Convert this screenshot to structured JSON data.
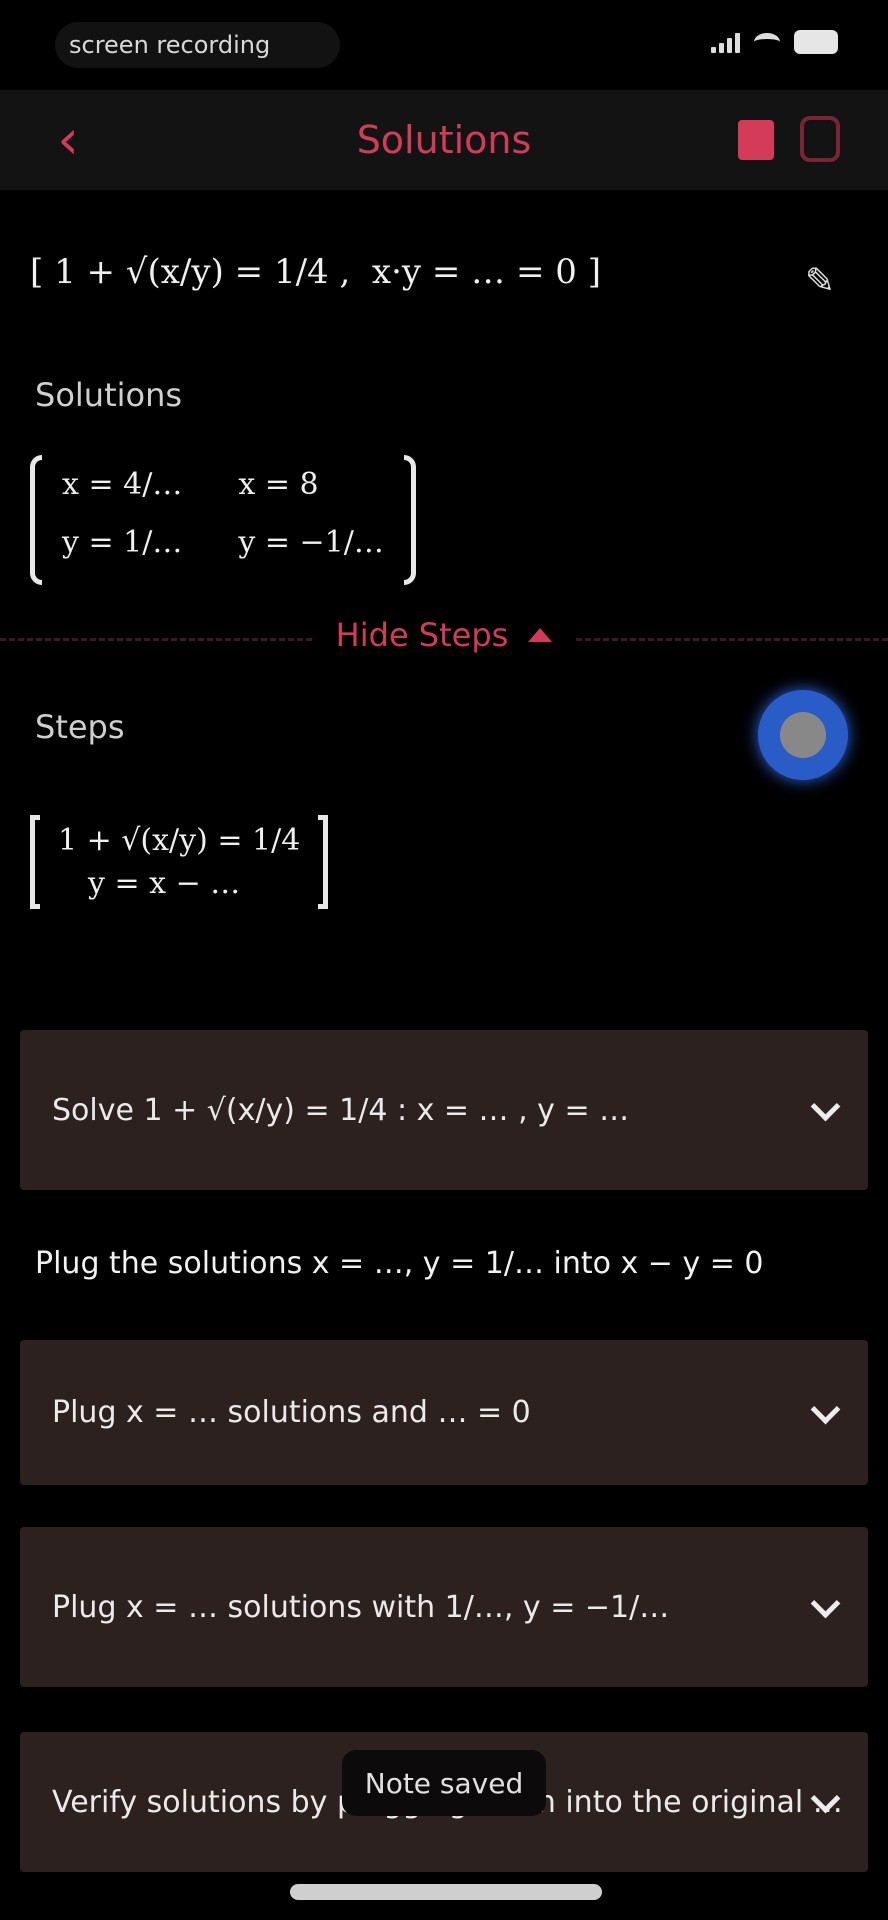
{
  "status_bar": {
    "left_pill_text": "screen recording",
    "battery_level": 1.0
  },
  "nav": {
    "back_icon": "chevron-left-icon",
    "title": "Solutions",
    "bookmark_icon": "bookmark-icon",
    "share_icon": "share-icon",
    "accent_color": "#d33b59"
  },
  "problem": {
    "expression": "[ 1 + √(x/y) = 1/4 ,  x·y = … = 0 ]",
    "edit_icon": "pencil-icon"
  },
  "solutions": {
    "label": "Solutions",
    "rows": [
      [
        "x = 4/…",
        "x = 8"
      ],
      [
        "y = 1/…",
        "y = −1/…"
      ]
    ]
  },
  "steps_toggle": {
    "label": "Hide Steps"
  },
  "steps": {
    "label": "Steps",
    "record_icon": "record-icon",
    "system_rows": [
      "1 + √(x/y) = 1/4",
      "y = x − …"
    ],
    "cards": [
      {
        "label": "Solve  1 + √(x/y) = 1/4 :  x = … , y = …"
      },
      {
        "label": "Plug x = … solutions and … = 0"
      },
      {
        "label": "Plug x = … solutions with 1/…, y = −1/…"
      },
      {
        "label": "Verify solutions by plugging them into the original …"
      }
    ],
    "plain_step": "Plug the solutions x = …, y = 1/… into x − y = 0"
  },
  "toast": {
    "text": "Note saved"
  }
}
